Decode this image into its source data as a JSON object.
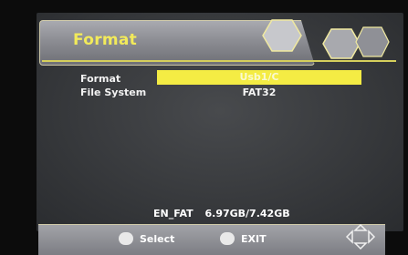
{
  "header": {
    "title": "Format"
  },
  "settings": [
    {
      "label": "Format",
      "value": "Usb1/C",
      "selected": true
    },
    {
      "label": "File System",
      "value": "FAT32",
      "selected": false
    }
  ],
  "storage": {
    "volume": "EN_FAT",
    "usage": "6.97GB/7.42GB"
  },
  "footer": {
    "select_label": "Select",
    "exit_label": "EXIT"
  },
  "icons": {
    "header_decor": "hexagon-icon",
    "navigation": "dpad-icon"
  },
  "colors": {
    "accent": "#f2ea5a",
    "selection": "#f4ec44",
    "panel": "#3a3c3f"
  }
}
